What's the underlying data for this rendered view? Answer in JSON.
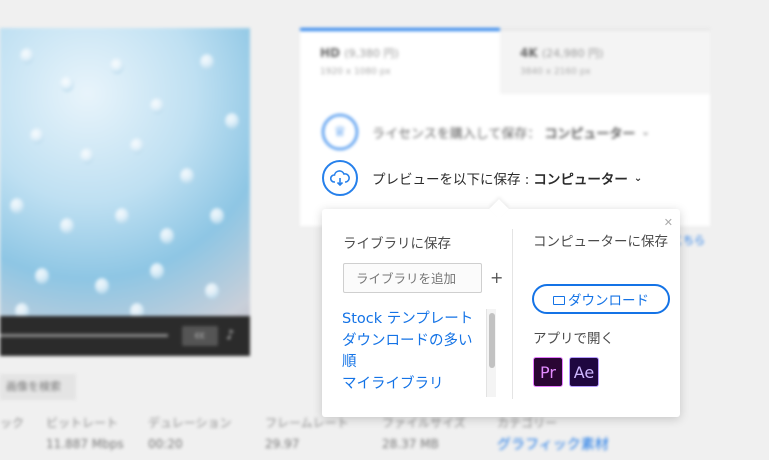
{
  "tabs": [
    {
      "name": "HD",
      "price": "(9,380 円)",
      "size": "1920 x 1080 px"
    },
    {
      "name": "4K",
      "price": "(24,980 円)",
      "size": "3840 x 2160 px"
    }
  ],
  "license_row": {
    "text": "ライセンスを購入して保存：",
    "target": "コンピューター"
  },
  "preview_row": {
    "text": "プレビューを以下に保存 :",
    "target": "コンピューター"
  },
  "popover": {
    "library_title": "ライブラリに保存",
    "add_library_placeholder": "ライブラリを追加",
    "library_items": [
      "Stock テンプレート",
      "ダウンロードの多い",
      "順",
      "マイライブラリ"
    ],
    "computer_title": "コンピューターに保存",
    "download_label": "ダウンロード",
    "open_in_app_title": "アプリで開く",
    "apps": [
      {
        "label": "Pr"
      },
      {
        "label": "Ae"
      }
    ]
  },
  "video": {
    "cc_label": "cc"
  },
  "find_similar_label": "画像を検索",
  "metadata": [
    {
      "label": "ック",
      "value": ""
    },
    {
      "label": "ビットレート",
      "value": "11.887 Mbps"
    },
    {
      "label": "デュレーション",
      "value": "00:20"
    },
    {
      "label": "フレームレート",
      "value": "29.97"
    },
    {
      "label": "ファイルサイズ",
      "value": "28.37 MB"
    },
    {
      "label": "カテゴリー",
      "value": "グラフィック素材"
    }
  ],
  "partial_link": "こちら",
  "colors": {
    "accent": "#1473e6",
    "premiere": "#e38cff",
    "after_effects": "#cdb7ff"
  }
}
